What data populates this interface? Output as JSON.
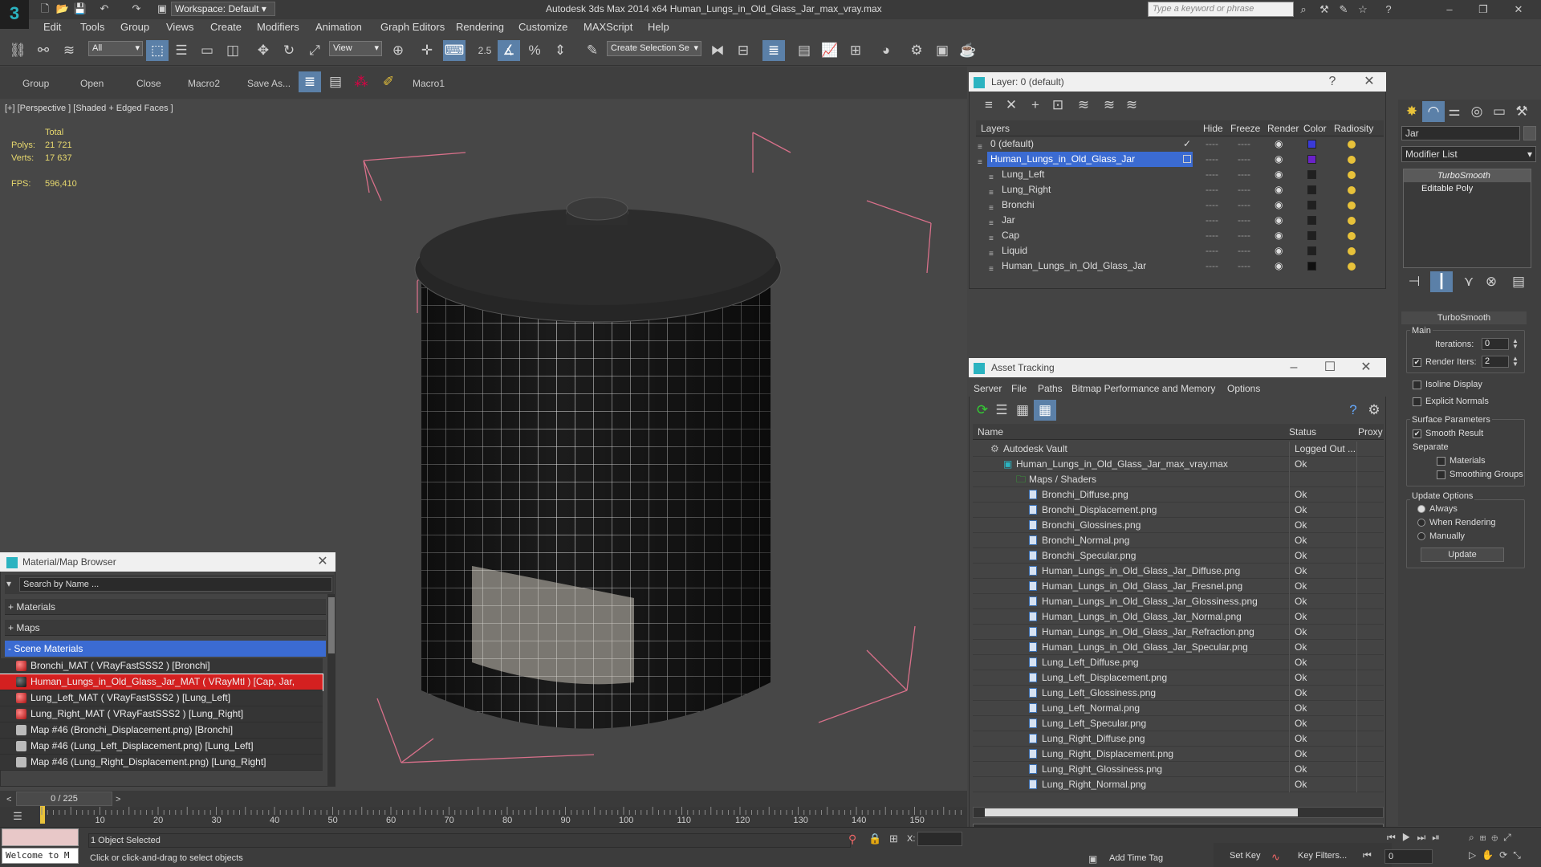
{
  "app": {
    "title": "Autodesk 3ds Max  2014 x64    Human_Lungs_in_Old_Glass_Jar_max_vray.max",
    "logo": "3",
    "workspace": "Workspace: Default",
    "search_placeholder": "Type a keyword or phrase"
  },
  "menu": [
    "Edit",
    "Tools",
    "Group",
    "Views",
    "Create",
    "Modifiers",
    "Animation",
    "Graph Editors",
    "Rendering",
    "Customize",
    "MAXScript",
    "Help"
  ],
  "toolbar": {
    "selection_filter": "All",
    "ref_coord": "View",
    "named_selection": "Create Selection Se",
    "snap_value": "2.5"
  },
  "macros": [
    "Group",
    "Open",
    "Close",
    "Macro2",
    "Save As...",
    "Macro1"
  ],
  "viewport": {
    "label": "[+] [Perspective ] [Shaded + Edged Faces ]",
    "stats": {
      "total_label": "Total",
      "polys_label": "Polys:",
      "polys": "21 721",
      "verts_label": "Verts:",
      "verts": "17 637",
      "fps_label": "FPS:",
      "fps": "596,410"
    }
  },
  "layer_dialog": {
    "title": "Layer: 0 (default)",
    "columns": [
      "Layers",
      "Hide",
      "Freeze",
      "Render",
      "Color",
      "Radiosity"
    ],
    "rows": [
      {
        "name": "0 (default)",
        "indent": 0,
        "color": "#3a3ad8",
        "selected": false,
        "checked": true
      },
      {
        "name": "Human_Lungs_in_Old_Glass_Jar",
        "indent": 0,
        "color": "#6a22c8",
        "selected": true,
        "checked": false
      },
      {
        "name": "Lung_Left",
        "indent": 1,
        "color": "#202020",
        "selected": false,
        "checked": false
      },
      {
        "name": "Lung_Right",
        "indent": 1,
        "color": "#202020",
        "selected": false,
        "checked": false
      },
      {
        "name": "Bronchi",
        "indent": 1,
        "color": "#202020",
        "selected": false,
        "checked": false
      },
      {
        "name": "Jar",
        "indent": 1,
        "color": "#202020",
        "selected": false,
        "checked": false
      },
      {
        "name": "Cap",
        "indent": 1,
        "color": "#202020",
        "selected": false,
        "checked": false
      },
      {
        "name": "Liquid",
        "indent": 1,
        "color": "#202020",
        "selected": false,
        "checked": false
      },
      {
        "name": "Human_Lungs_in_Old_Glass_Jar",
        "indent": 1,
        "color": "#101010",
        "selected": false,
        "checked": false
      }
    ]
  },
  "asset_tracking": {
    "title": "Asset Tracking",
    "menu": [
      "Server",
      "File",
      "Paths",
      "Bitmap Performance and Memory",
      "Options"
    ],
    "columns": [
      "Name",
      "Status",
      "Proxy"
    ],
    "rows": [
      {
        "name": "Autodesk Vault",
        "status": "Logged Out ...",
        "indent": 1,
        "kind": "vault"
      },
      {
        "name": "Human_Lungs_in_Old_Glass_Jar_max_vray.max",
        "status": "Ok",
        "indent": 2,
        "kind": "max"
      },
      {
        "name": "Maps / Shaders",
        "status": "",
        "indent": 3,
        "kind": "folder"
      },
      {
        "name": "Bronchi_Diffuse.png",
        "status": "Ok",
        "indent": 4,
        "kind": "file"
      },
      {
        "name": "Bronchi_Displacement.png",
        "status": "Ok",
        "indent": 4,
        "kind": "file"
      },
      {
        "name": "Bronchi_Glossines.png",
        "status": "Ok",
        "indent": 4,
        "kind": "file"
      },
      {
        "name": "Bronchi_Normal.png",
        "status": "Ok",
        "indent": 4,
        "kind": "file"
      },
      {
        "name": "Bronchi_Specular.png",
        "status": "Ok",
        "indent": 4,
        "kind": "file"
      },
      {
        "name": "Human_Lungs_in_Old_Glass_Jar_Diffuse.png",
        "status": "Ok",
        "indent": 4,
        "kind": "file"
      },
      {
        "name": "Human_Lungs_in_Old_Glass_Jar_Fresnel.png",
        "status": "Ok",
        "indent": 4,
        "kind": "file"
      },
      {
        "name": "Human_Lungs_in_Old_Glass_Jar_Glossiness.png",
        "status": "Ok",
        "indent": 4,
        "kind": "file"
      },
      {
        "name": "Human_Lungs_in_Old_Glass_Jar_Normal.png",
        "status": "Ok",
        "indent": 4,
        "kind": "file"
      },
      {
        "name": "Human_Lungs_in_Old_Glass_Jar_Refraction.png",
        "status": "Ok",
        "indent": 4,
        "kind": "file"
      },
      {
        "name": "Human_Lungs_in_Old_Glass_Jar_Specular.png",
        "status": "Ok",
        "indent": 4,
        "kind": "file"
      },
      {
        "name": "Lung_Left_Diffuse.png",
        "status": "Ok",
        "indent": 4,
        "kind": "file"
      },
      {
        "name": "Lung_Left_Displacement.png",
        "status": "Ok",
        "indent": 4,
        "kind": "file"
      },
      {
        "name": "Lung_Left_Glossiness.png",
        "status": "Ok",
        "indent": 4,
        "kind": "file"
      },
      {
        "name": "Lung_Left_Normal.png",
        "status": "Ok",
        "indent": 4,
        "kind": "file"
      },
      {
        "name": "Lung_Left_Specular.png",
        "status": "Ok",
        "indent": 4,
        "kind": "file"
      },
      {
        "name": "Lung_Right_Diffuse.png",
        "status": "Ok",
        "indent": 4,
        "kind": "file"
      },
      {
        "name": "Lung_Right_Displacement.png",
        "status": "Ok",
        "indent": 4,
        "kind": "file"
      },
      {
        "name": "Lung_Right_Glossiness.png",
        "status": "Ok",
        "indent": 4,
        "kind": "file"
      },
      {
        "name": "Lung_Right_Normal.png",
        "status": "Ok",
        "indent": 4,
        "kind": "file"
      }
    ]
  },
  "material_browser": {
    "title": "Material/Map Browser",
    "search_placeholder": "Search by Name ...",
    "sections": [
      {
        "label": "+ Materials"
      },
      {
        "label": "+ Maps"
      },
      {
        "label": "- Scene Materials"
      }
    ],
    "items": [
      {
        "label": "Bronchi_MAT ( VRayFastSSS2 ) [Bronchi]",
        "icon": "sphere-red",
        "highlight": false
      },
      {
        "label": "Human_Lungs_in_Old_Glass_Jar_MAT ( VRayMtl ) [Cap, Jar, Liquid]",
        "icon": "sphere-dark",
        "highlight": true
      },
      {
        "label": "Lung_Left_MAT ( VRayFastSSS2 ) [Lung_Left]",
        "icon": "sphere-red",
        "highlight": false
      },
      {
        "label": "Lung_Right_MAT ( VRayFastSSS2 ) [Lung_Right]",
        "icon": "sphere-red",
        "highlight": false
      },
      {
        "label": "Map #46 (Bronchi_Displacement.png) [Bronchi]",
        "icon": "map-gray",
        "highlight": false
      },
      {
        "label": "Map #46 (Lung_Left_Displacement.png) [Lung_Left]",
        "icon": "map-gray",
        "highlight": false
      },
      {
        "label": "Map #46 (Lung_Right_Displacement.png) [Lung_Right]",
        "icon": "map-gray",
        "highlight": false
      }
    ]
  },
  "command_panel": {
    "object_name": "Jar",
    "modifier_list": "Modifier List",
    "stack": [
      {
        "label": "TurboSmooth",
        "italic": true
      },
      {
        "label": "Editable Poly",
        "italic": false
      }
    ],
    "rollout_title": "TurboSmooth",
    "main_label": "Main",
    "iterations_label": "Iterations:",
    "iterations": "0",
    "render_iters_label": "Render Iters:",
    "render_iters": "2",
    "isoline": "Isoline Display",
    "explicit_normals": "Explicit Normals",
    "surface_params": "Surface Parameters",
    "smooth_result": "Smooth Result",
    "separate": "Separate",
    "materials": "Materials",
    "smoothing_groups": "Smoothing Groups",
    "update_options": "Update Options",
    "always": "Always",
    "when_rendering": "When Rendering",
    "manually": "Manually",
    "update_btn": "Update"
  },
  "timeline": {
    "frame": "0 / 225",
    "ticks": [
      "10",
      "20",
      "30",
      "40",
      "50",
      "60",
      "70",
      "80",
      "90",
      "100",
      "110",
      "120",
      "130",
      "140",
      "150"
    ]
  },
  "status": {
    "maxscript": "Welcome to M",
    "selected": "1 Object Selected",
    "prompt": "Click or click-and-drag to select objects",
    "x_label": "X:",
    "add_time_tag": "Add Time Tag",
    "set_key": "Set Key",
    "key_filters": "Key Filters...",
    "frame_field": "0"
  },
  "colors": {
    "selection_blue": "#3b6bd2",
    "accent_teal": "#2bb3c0",
    "bbox_pink": "#d8708a",
    "highlight_red": "#d42020"
  }
}
